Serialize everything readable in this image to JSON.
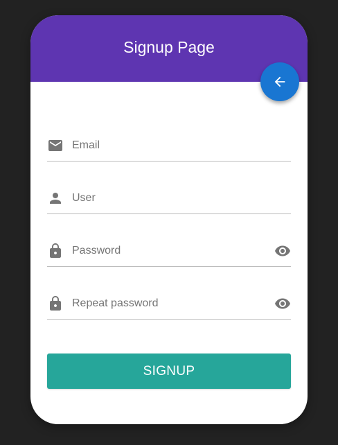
{
  "header": {
    "title": "Signup Page",
    "color": "#5e35b1"
  },
  "back_button": {
    "icon": "arrow-left-icon",
    "color": "#1976d2"
  },
  "fields": [
    {
      "icon": "email-icon",
      "placeholder": "Email",
      "value": ""
    },
    {
      "icon": "person-icon",
      "placeholder": "User",
      "value": ""
    },
    {
      "icon": "lock-icon",
      "placeholder": "Password",
      "value": "",
      "toggle_icon": "eye-icon"
    },
    {
      "icon": "lock-icon",
      "placeholder": "Repeat password",
      "value": "",
      "toggle_icon": "eye-icon"
    }
  ],
  "signup_button": {
    "label": "SIGNUP",
    "color": "#26a69a"
  }
}
